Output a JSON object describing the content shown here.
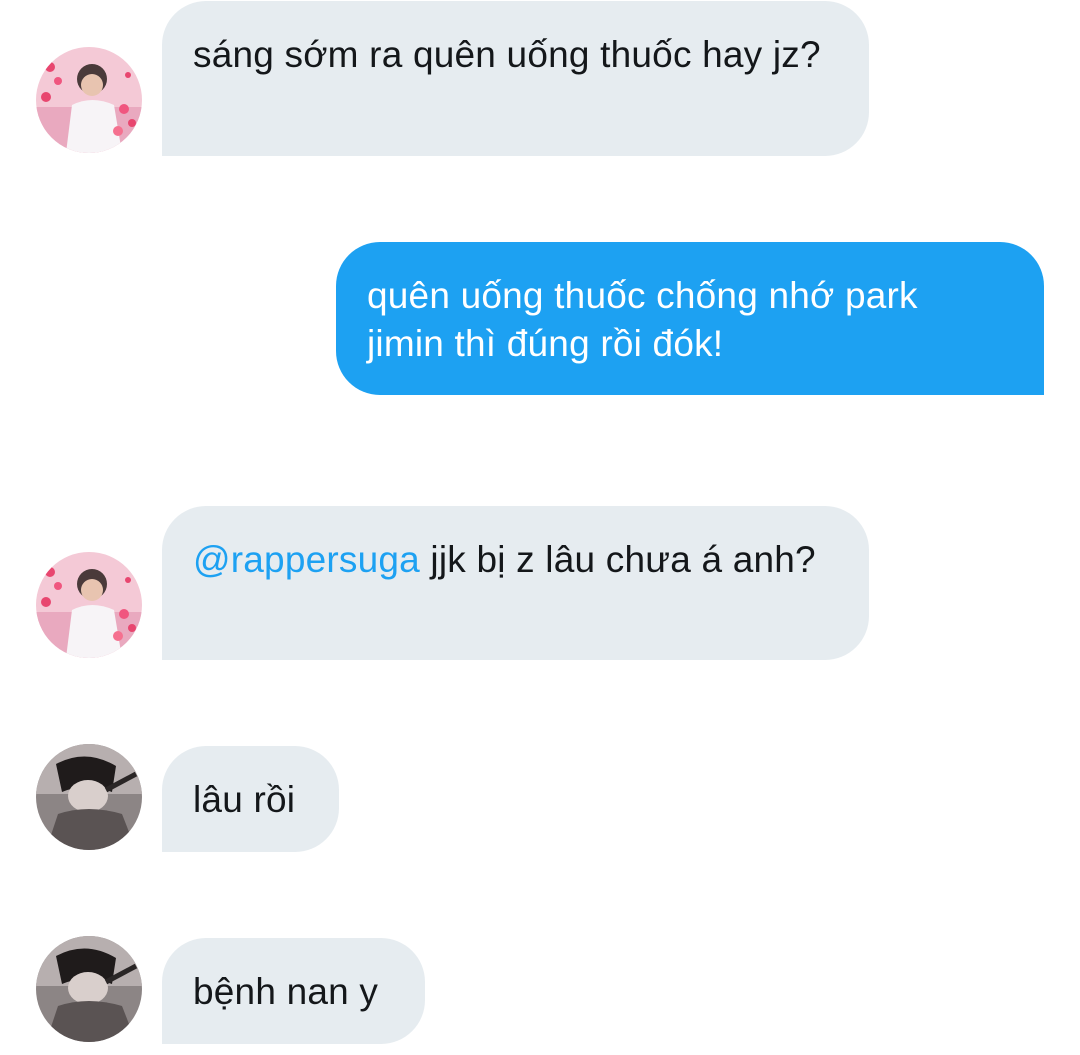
{
  "messages": [
    {
      "sender_avatar": "pink-heart-photo-avatar",
      "direction": "incoming",
      "text": "sáng sớm ra quên uống thuốc hay jz?"
    },
    {
      "direction": "outgoing",
      "text": "quên uống thuốc chống nhớ park jimin thì đúng rồi đók!"
    },
    {
      "sender_avatar": "pink-heart-photo-avatar",
      "direction": "incoming",
      "mention": "@rappersuga",
      "text": " jjk bị z lâu chưa á anh?"
    },
    {
      "sender_avatar": "dark-photo-avatar",
      "direction": "incoming",
      "text": "lâu rồi"
    },
    {
      "sender_avatar": "dark-photo-avatar",
      "direction": "incoming",
      "text": "bệnh nan y"
    }
  ],
  "colors": {
    "incoming_bubble": "#e6ecf0",
    "outgoing_bubble": "#1da1f2",
    "mention": "#1da1f2",
    "text_dark": "#14171a"
  }
}
